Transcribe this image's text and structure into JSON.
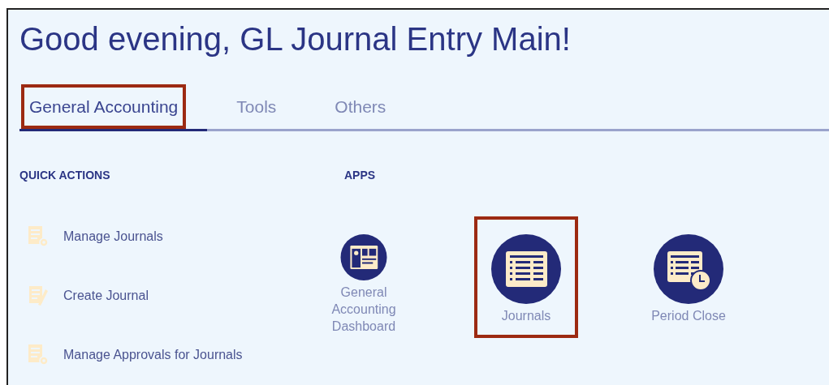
{
  "greeting": "Good evening, GL Journal Entry Main!",
  "tabs": [
    {
      "label": "General Accounting",
      "selected": true,
      "highlighted": true
    },
    {
      "label": "Tools",
      "selected": false,
      "highlighted": false
    },
    {
      "label": "Others",
      "selected": false,
      "highlighted": false
    }
  ],
  "quick_actions": {
    "heading": "QUICK ACTIONS",
    "items": [
      {
        "label": "Manage Journals",
        "kind": "manage"
      },
      {
        "label": "Create Journal",
        "kind": "create"
      },
      {
        "label": "Manage Approvals for Journals",
        "kind": "manage"
      }
    ]
  },
  "apps": {
    "heading": "APPS",
    "items": [
      {
        "label": "General Accounting Dashboard",
        "kind": "dashboard",
        "highlighted": false
      },
      {
        "label": "Journals",
        "kind": "journals",
        "highlighted": true
      },
      {
        "label": "Period Close",
        "kind": "period",
        "highlighted": false
      }
    ]
  }
}
